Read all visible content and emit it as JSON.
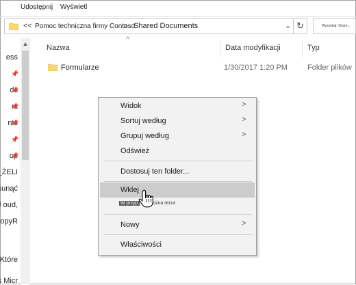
{
  "ribbon": {
    "tabs": [
      "Udostępnij",
      "Wyświetl"
    ]
  },
  "address": {
    "crumbs": [
      "Pomoc techniczna firmy Contoso",
      "Shared Documents"
    ],
    "back_glyph": "<<",
    "separator_glyph": ">"
  },
  "search": {
    "placeholder": "Wyszukaj: Share..."
  },
  "nav": {
    "items": [
      "ess",
      "ds",
      "nt",
      "nts",
      "op",
      "J_ŻELI",
      "r usunąć",
      "r U oud,",
      "CopyR",
      "Które",
      "ś Micr"
    ]
  },
  "columns": {
    "name": "Nazwa",
    "modified": "Data modyfikacji",
    "type": "Typ"
  },
  "files": [
    {
      "name": "Formularze",
      "modified": "1/30/2017 1:20 PM",
      "type": "Folder plików"
    }
  ],
  "context_menu": {
    "items": {
      "view": "Widok",
      "sort_by": "Sortuj według",
      "group_by": "Grupuj według",
      "refresh": "Odśwież",
      "customize": "Dostosuj ten folder...",
      "paste": "Wklej",
      "new": "Nowy",
      "properties": "Właściwości"
    },
    "tooltip_boxed": "W przyp",
    "tooltip_rest": "można recut"
  },
  "colors": {
    "accent": "#0078d7",
    "folder": "#f8d775",
    "highlight": "#cccccc"
  },
  "icons": [
    "folder-icon",
    "refresh-icon",
    "chevron-down-icon",
    "pin-icon",
    "submenu-arrow-icon",
    "hand-cursor-icon"
  ]
}
